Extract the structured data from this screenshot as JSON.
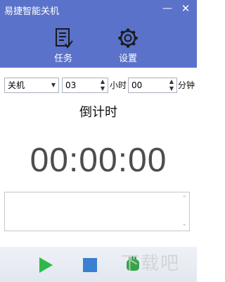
{
  "window": {
    "title": "易捷智能关机",
    "minimize_glyph": "—",
    "close_glyph": "✕",
    "accent_color": "#5a72c9"
  },
  "toolbar": {
    "tasks_label": "任务",
    "settings_label": "设置"
  },
  "controls": {
    "action_value": "关机",
    "hours_value": "03",
    "hours_unit": "小时",
    "minutes_value": "00",
    "minutes_unit": "分钟"
  },
  "timer": {
    "label": "倒计时",
    "display": "00:00:00"
  },
  "bottom": {
    "play_icon": "play-icon",
    "stop_icon": "stop-icon",
    "hand_icon": "hand-icon"
  },
  "watermark_text": "下载吧"
}
